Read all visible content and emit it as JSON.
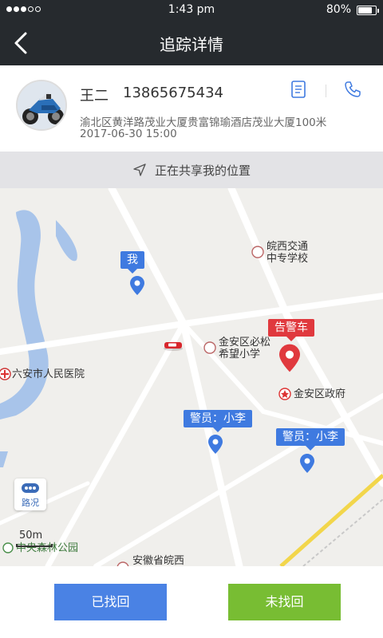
{
  "status_bar": {
    "time": "1:43 pm",
    "battery": "80%",
    "battery_level": 0.8,
    "signal_filled": 3,
    "signal_total": 5
  },
  "nav": {
    "title": "追踪详情",
    "back_icon": "chevron-left-icon"
  },
  "contact": {
    "name": "王二",
    "phone": "13865675434",
    "address": "渝北区黄洋路茂业大厦贵富锦瑜酒店茂业大厦100米",
    "datetime": "2017-06-30 15:00",
    "avatar_icon": "motorcycle-avatar",
    "doc_icon": "document-icon",
    "call_icon": "phone-icon"
  },
  "sharing": {
    "text": "正在共享我的位置",
    "icon": "navigation-arrow-icon"
  },
  "map": {
    "places": {
      "school": [
        "皖西交通",
        "中专学校"
      ],
      "hospital": "六安市人民医院",
      "primary": [
        "金安区必松",
        "希望小学"
      ],
      "government": "金安区政府",
      "park": "中央森林公园",
      "bottom": "安徽省皖西"
    },
    "markers": {
      "me": "我",
      "alarm_car": "告警车",
      "officer_1": "警员：小李",
      "officer_2": "警员：小李"
    },
    "traffic_label": "路况",
    "scale": "50m",
    "colors": {
      "blue_pin": "#3f7ae0",
      "red_pin": "#e0393e",
      "river": "#a8c4ea",
      "road": "#ffffff",
      "rail": "#f2d64b"
    }
  },
  "actions": {
    "found": "已找回",
    "not_found": "未找回"
  },
  "colors": {
    "header_bg": "#262a2e",
    "found_btn": "#4a82e4",
    "not_found_btn": "#78bd33"
  }
}
